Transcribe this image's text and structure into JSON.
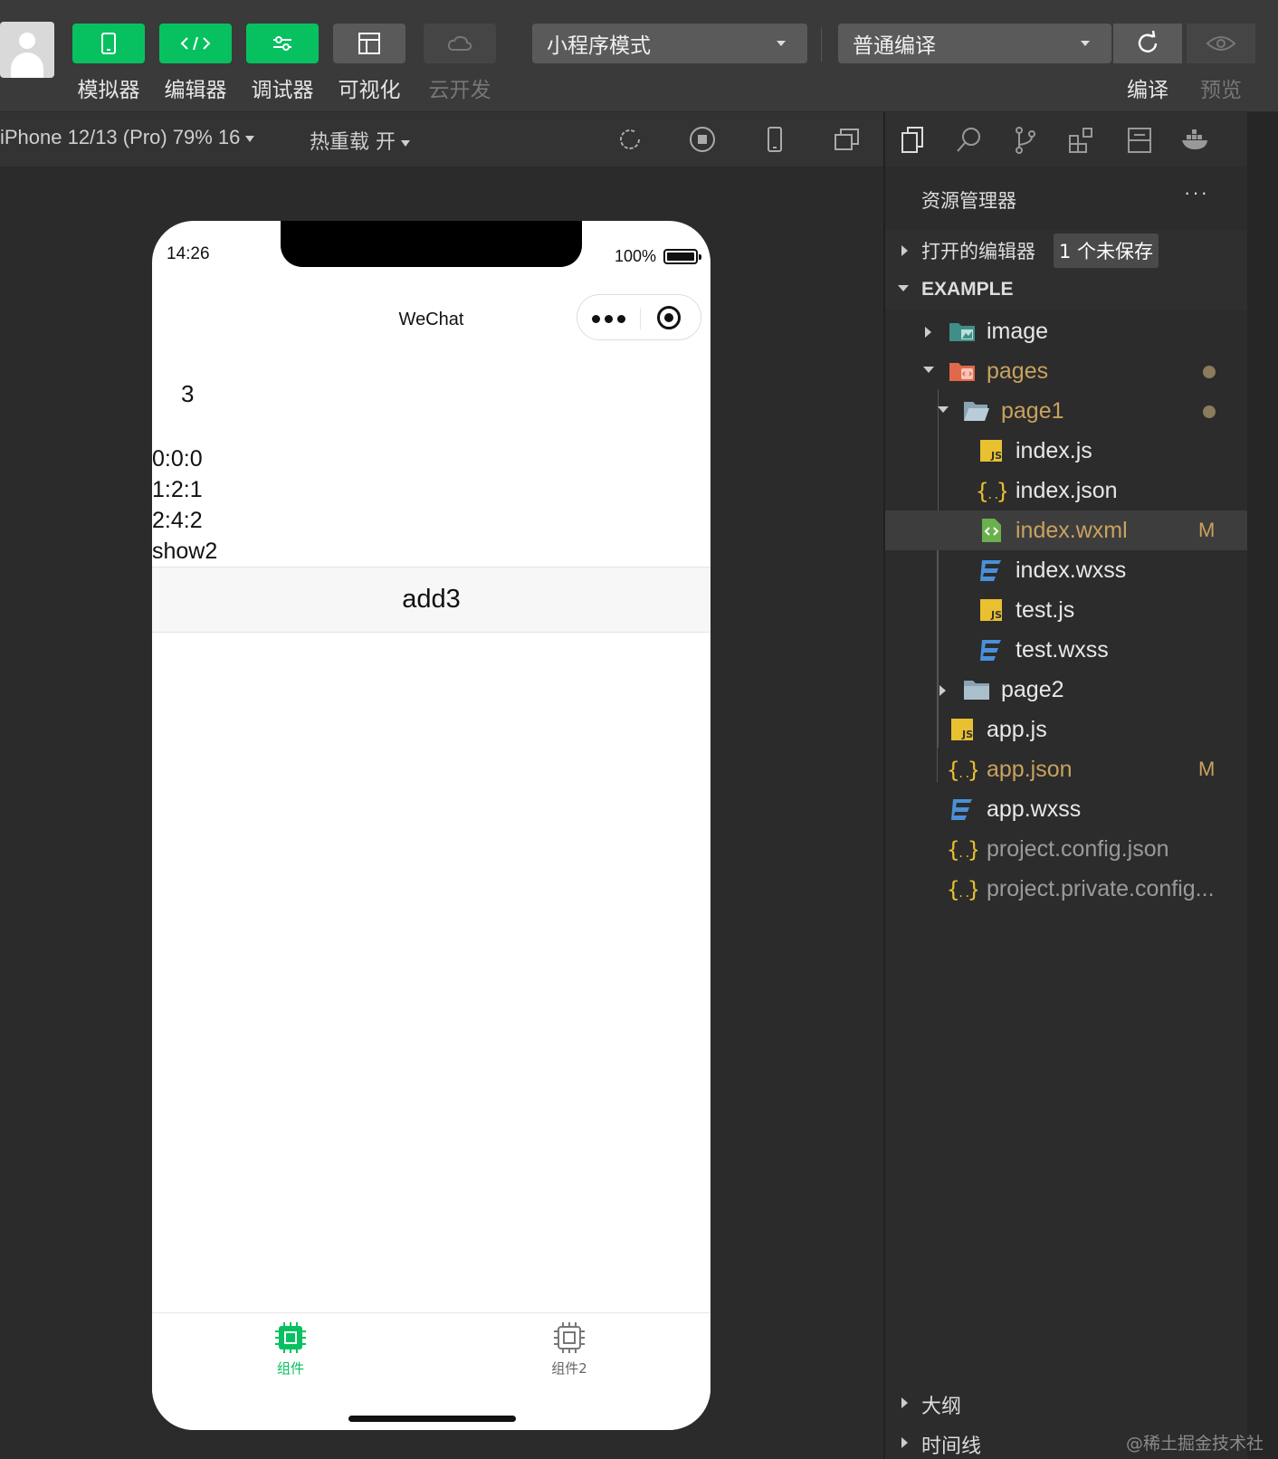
{
  "toolbar": {
    "tools": [
      {
        "label": "模拟器",
        "icon": "phone-icon"
      },
      {
        "label": "编辑器",
        "icon": "code-icon"
      },
      {
        "label": "调试器",
        "icon": "debug-icon"
      },
      {
        "label": "可视化",
        "icon": "layout-icon"
      },
      {
        "label": "云开发",
        "icon": "cloud-icon"
      }
    ],
    "mode_select": "小程序模式",
    "compile_select": "普通编译",
    "compile_label": "编译",
    "preview_label": "预览"
  },
  "simulator": {
    "device": "iPhone 12/13 (Pro) 79% 16",
    "hot_reload": "热重载 开"
  },
  "phone": {
    "time": "14:26",
    "battery": "100%",
    "nav_title": "WeChat",
    "count": "3",
    "lines": [
      "0:0:0",
      "1:2:1",
      "2:4:2",
      "show2"
    ],
    "button": "add3",
    "tabs": [
      {
        "label": "组件",
        "active": true,
        "color": "#07c160"
      },
      {
        "label": "组件2",
        "active": false,
        "color": "#666666"
      }
    ]
  },
  "explorer": {
    "title": "资源管理器",
    "more": "···",
    "open_editors": "打开的编辑器",
    "unsaved": "1 个未保存",
    "root": "EXAMPLE",
    "items": [
      {
        "name": "image",
        "icon": "image-folder-icon"
      },
      {
        "name": "pages",
        "icon": "pages-folder-icon"
      },
      {
        "name": "page1",
        "icon": "folder-open-icon"
      },
      {
        "name": "index.js",
        "icon": "js-file-icon"
      },
      {
        "name": "index.json",
        "icon": "json-file-icon"
      },
      {
        "name": "index.wxml",
        "icon": "wxml-file-icon",
        "badge": "M"
      },
      {
        "name": "index.wxss",
        "icon": "css-file-icon"
      },
      {
        "name": "test.js",
        "icon": "js-file-icon"
      },
      {
        "name": "test.wxss",
        "icon": "css-file-icon"
      },
      {
        "name": "page2",
        "icon": "folder-icon"
      },
      {
        "name": "app.js",
        "icon": "js-file-icon"
      },
      {
        "name": "app.json",
        "icon": "json-file-icon",
        "badge": "M"
      },
      {
        "name": "app.wxss",
        "icon": "css-file-icon"
      },
      {
        "name": "project.config.json",
        "icon": "json-file-icon"
      },
      {
        "name": "project.private.config...",
        "icon": "json-file-icon"
      }
    ],
    "outline": "大纲",
    "timeline": "时间线"
  },
  "watermark": "@稀土掘金技术社区",
  "colors": {
    "accent": "#07c160",
    "modified": "#c9a25e",
    "js": "#e8c030",
    "css": "#4a90d9"
  }
}
